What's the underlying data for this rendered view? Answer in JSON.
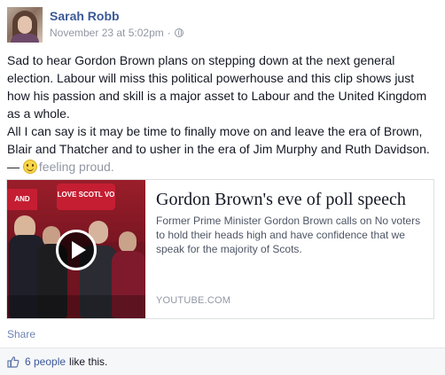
{
  "post": {
    "author": "Sarah Robb",
    "timestamp": "November 23 at 5:02pm",
    "separator": "·",
    "privacy_icon": "globe-icon",
    "paragraphs": [
      "Sad to hear Gordon Brown plans on stepping down at the next general election. Labour will miss this political powerhouse and this clip shows just how his passion and skill is a major asset to Labour and the United Kingdom as a whole.",
      "All I can say is it may be time to finally move on and leave the era of Brown, Blair and Thatcher and to usher in the era of Jim Murphy and Ruth Davidson. —"
    ],
    "feeling": "feeling proud."
  },
  "share_card": {
    "thumb_sign_left": "AND",
    "thumb_sign_center": "LOVE SCOTL VO",
    "title": "Gordon Brown's eve of poll speech",
    "description": "Former Prime Minister Gordon Brown calls on No voters to hold their heads high and have confidence that we speak for the majority of Scots.",
    "source": "YOUTUBE.COM"
  },
  "actions": {
    "share_label": "Share"
  },
  "likes": {
    "count_label": "6 people",
    "suffix": "like this."
  },
  "colors": {
    "link_blue": "#3b5998",
    "meta_gray": "#9197a3",
    "likes_bg": "#f6f7f9"
  }
}
